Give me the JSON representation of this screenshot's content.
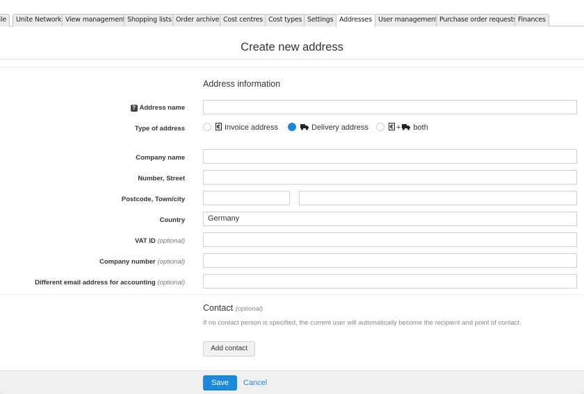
{
  "tabs": [
    {
      "label": "Profile"
    },
    {
      "label": "Unite Network"
    },
    {
      "label": "View management"
    },
    {
      "label": "Shopping lists"
    },
    {
      "label": "Order archive"
    },
    {
      "label": "Cost centres"
    },
    {
      "label": "Cost types"
    },
    {
      "label": "Settings"
    },
    {
      "label": "Addresses",
      "active": true
    },
    {
      "label": "User management"
    },
    {
      "label": "Purchase order requests"
    },
    {
      "label": "Finances"
    }
  ],
  "page": {
    "title": "Create new address"
  },
  "address_section": {
    "title": "Address information"
  },
  "fields": {
    "address_name": {
      "label": "Address name",
      "value": ""
    },
    "type_of_address": {
      "label": "Type of address",
      "options": [
        {
          "label": "Invoice address",
          "icon": "invoice-icon",
          "selected": false
        },
        {
          "label": "Delivery address",
          "icon": "truck-icon",
          "selected": true
        },
        {
          "label": "both",
          "icon": "invoice-truck-icon",
          "selected": false
        }
      ]
    },
    "company_name": {
      "label": "Company name",
      "value": ""
    },
    "number_street": {
      "label": "Number, Street",
      "value": ""
    },
    "postcode_town": {
      "label": "Postcode, Town/city",
      "postcode": "",
      "town": ""
    },
    "country": {
      "label": "Country",
      "value": "Germany"
    },
    "vat_id": {
      "label": "VAT ID",
      "optional": "(optional)",
      "value": ""
    },
    "company_number": {
      "label": "Company number",
      "optional": "(optional)",
      "value": ""
    },
    "accounting_email": {
      "label": "Different email address for accounting",
      "optional": "(optional)",
      "value": ""
    }
  },
  "contact_section": {
    "title": "Contact",
    "optional": "(optional)",
    "help": "If no contact person is specified, the current user will automatically become the recipient and point of contact.",
    "add_button": "Add contact"
  },
  "footer": {
    "save": "Save",
    "cancel": "Cancel"
  },
  "colors": {
    "accent": "#1c8ad8",
    "footer_bg": "#f0f0f0"
  }
}
